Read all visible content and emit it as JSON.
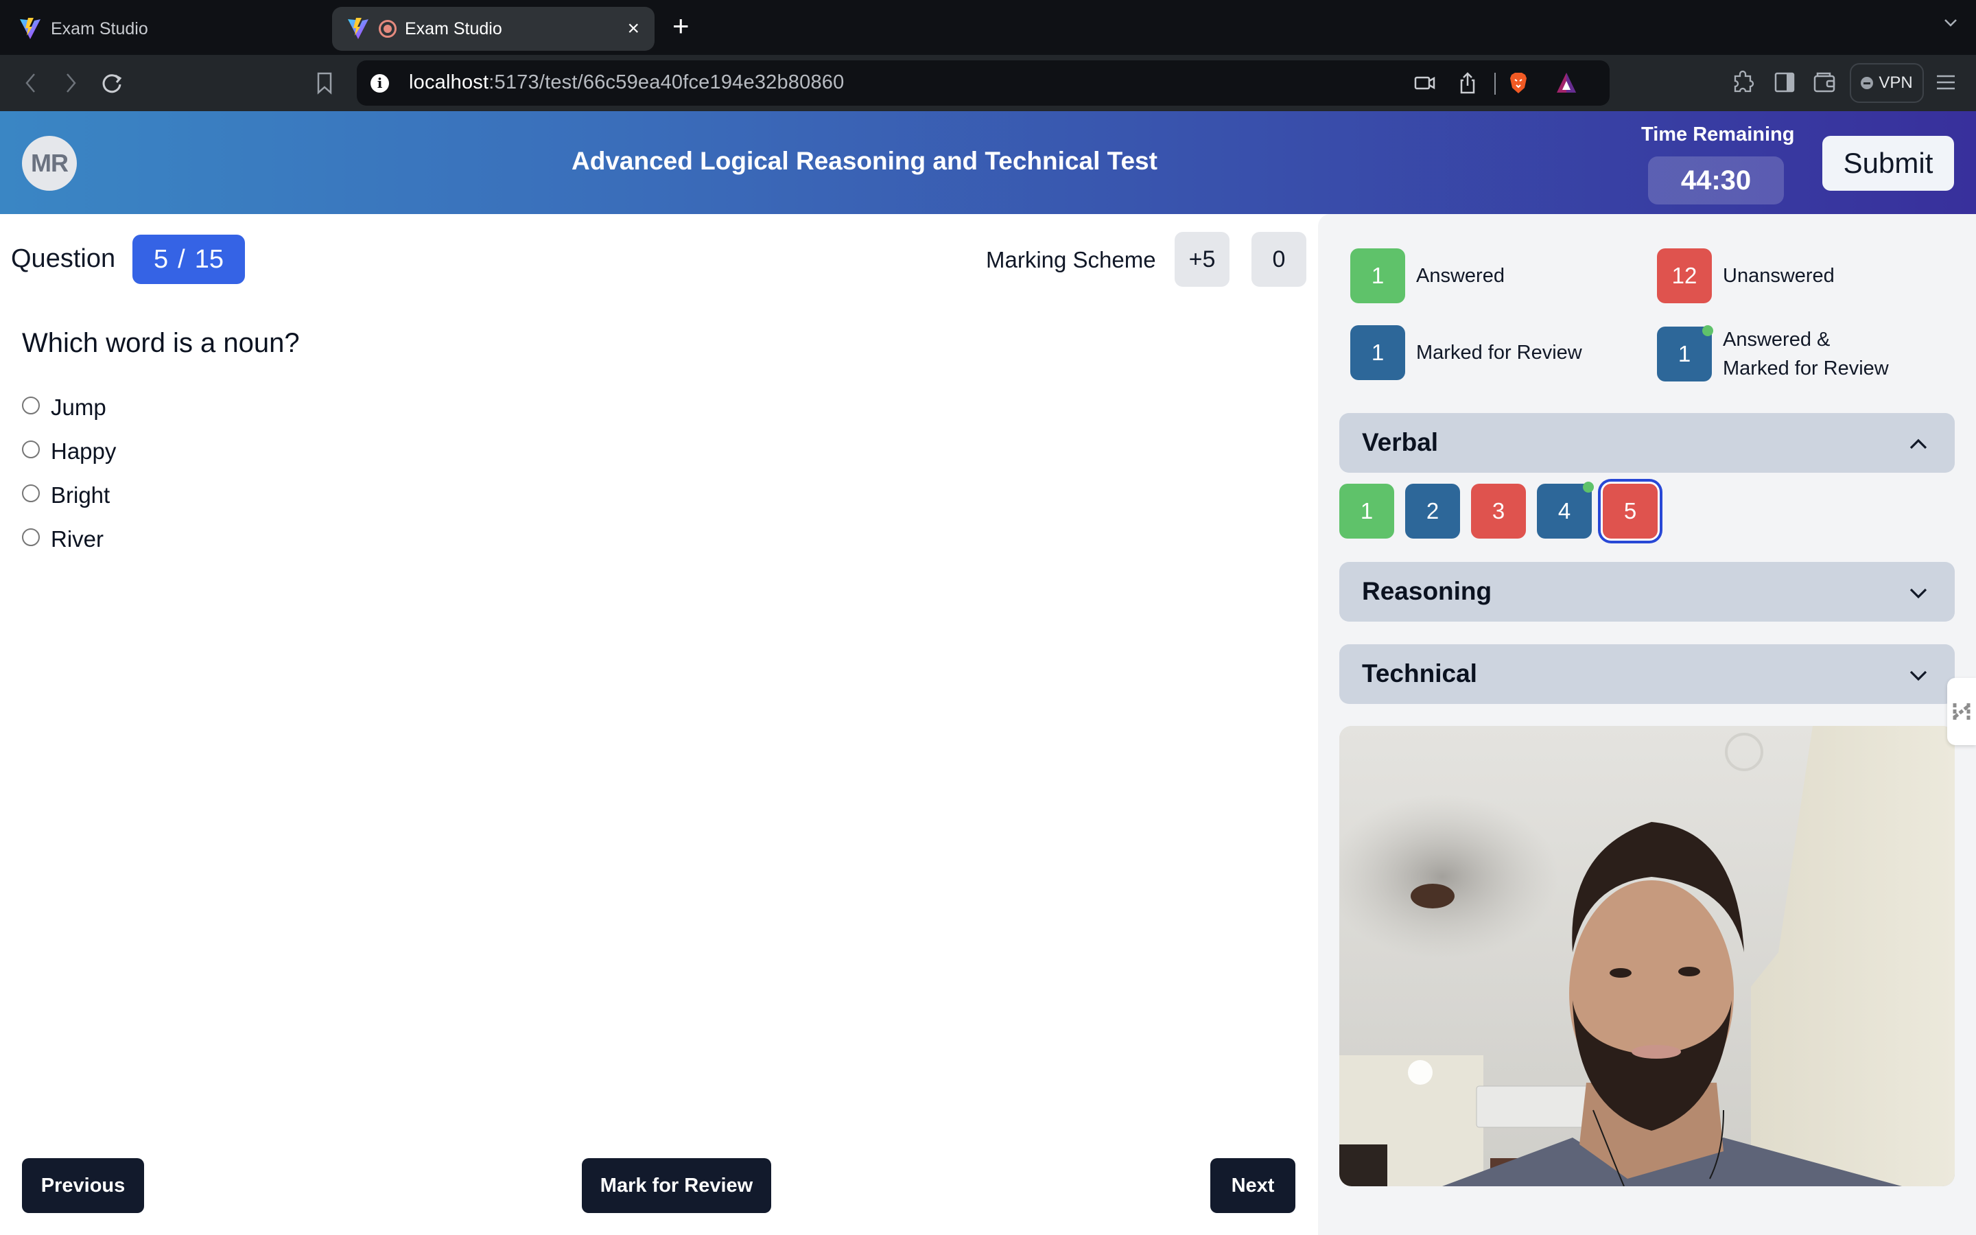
{
  "browser": {
    "tabs": [
      {
        "label": "Exam Studio",
        "active": false
      },
      {
        "label": "Exam Studio",
        "active": true,
        "recording": true
      }
    ],
    "new_tab_label": "+",
    "close_tab_label": "×",
    "url_host": "localhost",
    "url_path": ":5173/test/66c59ea40fce194e32b80860",
    "vpn_label": "VPN"
  },
  "header": {
    "avatar_initials": "MR",
    "title": "Advanced Logical Reasoning and Technical Test",
    "time_remaining_label": "Time Remaining",
    "time_remaining": "44:30",
    "submit_label": "Submit"
  },
  "question": {
    "label": "Question",
    "current": "5",
    "separator": "/",
    "total": "15",
    "marking_scheme_label": "Marking Scheme",
    "marks_correct": "+5",
    "marks_wrong": "0",
    "text": "Which word is a noun?",
    "options": [
      "Jump",
      "Happy",
      "Bright",
      "River"
    ],
    "selected_option": null
  },
  "footer": {
    "previous_label": "Previous",
    "mark_review_label": "Mark for Review",
    "next_label": "Next"
  },
  "legend": [
    {
      "count": "1",
      "label": "Answered",
      "status": "answered"
    },
    {
      "count": "12",
      "label": "Unanswered",
      "status": "unanswered"
    },
    {
      "count": "1",
      "label": "Marked for Review",
      "status": "marked"
    },
    {
      "count": "1",
      "label": "Answered &\nMarked for Review",
      "label_line1": "Answered &",
      "label_line2": "Marked for Review",
      "status": "answered-marked"
    }
  ],
  "sections": [
    {
      "name": "Verbal",
      "expanded": true,
      "questions": [
        {
          "number": "1",
          "status": "answered"
        },
        {
          "number": "2",
          "status": "marked"
        },
        {
          "number": "3",
          "status": "unanswered"
        },
        {
          "number": "4",
          "status": "answered-marked"
        },
        {
          "number": "5",
          "status": "unanswered",
          "current": true
        }
      ]
    },
    {
      "name": "Reasoning",
      "expanded": false
    },
    {
      "name": "Technical",
      "expanded": false
    }
  ],
  "colors": {
    "answered": "#5fc26a",
    "unanswered": "#df534e",
    "marked": "#2d6799",
    "current_ring": "#2848d6",
    "question_badge": "#3563e5",
    "dark_button": "#121a2c",
    "header_gradient_start": "#3a86c4",
    "header_gradient_end": "#38309c"
  },
  "webcam": {
    "description": "live proctoring camera feed"
  }
}
